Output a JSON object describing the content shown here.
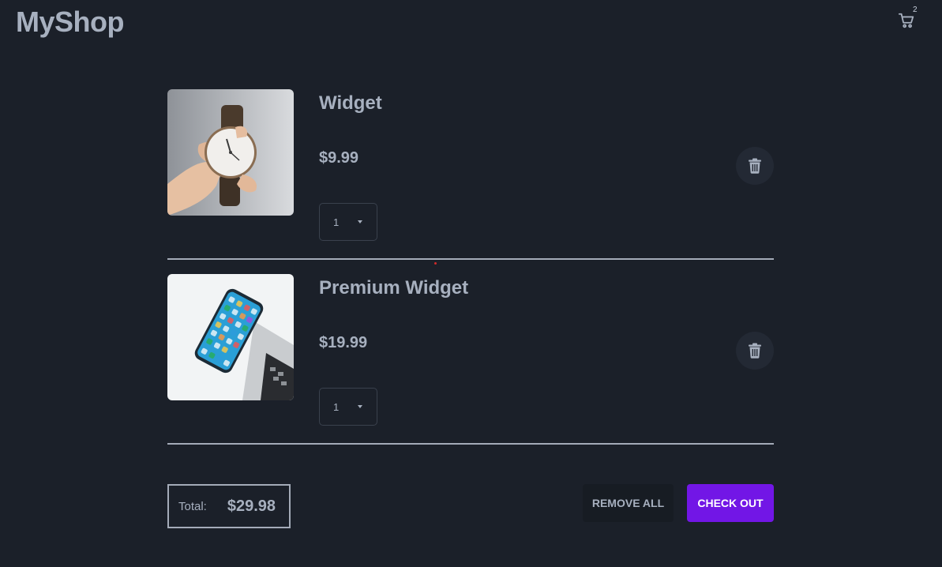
{
  "header": {
    "brand": "MyShop",
    "cart_icon": "shopping-cart-icon",
    "cart_count": "2"
  },
  "cart": {
    "items": [
      {
        "name": "Widget",
        "price": "$9.99",
        "quantity": "1",
        "image_icon": "wristwatch-photo",
        "delete_icon": "trash-icon"
      },
      {
        "name": "Premium Widget",
        "price": "$19.99",
        "quantity": "1",
        "image_icon": "smartphone-photo",
        "delete_icon": "trash-icon"
      }
    ]
  },
  "footer": {
    "total_label": "Total:",
    "total_value": "$29.98",
    "remove_all_label": "REMOVE ALL",
    "checkout_label": "CHECK OUT"
  },
  "colors": {
    "background": "#1b2029",
    "text": "#a7b0bf",
    "accent": "#7216e6",
    "divider": "#a4abb8"
  }
}
